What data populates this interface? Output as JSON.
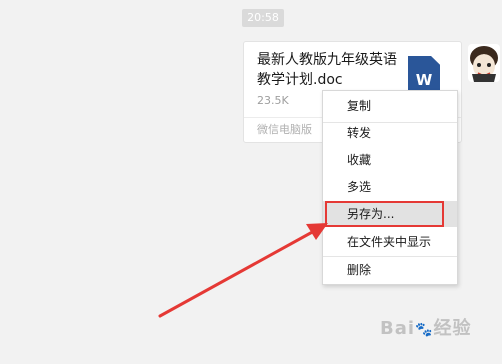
{
  "chat": {
    "timestamp": "20:58",
    "file_message": {
      "file_name": "最新人教版九年级英语教学计划.doc",
      "file_size": "23.5K",
      "source": "微信电脑版",
      "icon": "word-doc-icon",
      "icon_letter": "W"
    }
  },
  "context_menu": {
    "items": [
      {
        "label": "复制"
      },
      {
        "label": "转发"
      },
      {
        "label": "收藏"
      },
      {
        "label": "多选"
      },
      {
        "label": "另存为..."
      },
      {
        "label": "在文件夹中显示"
      },
      {
        "label": "删除"
      }
    ],
    "hovered_item": "另存为..."
  },
  "annotation": {
    "color": "#e53935"
  },
  "watermark": {
    "text": "Bai",
    "tail": "经验",
    "icon": "paw-icon"
  }
}
